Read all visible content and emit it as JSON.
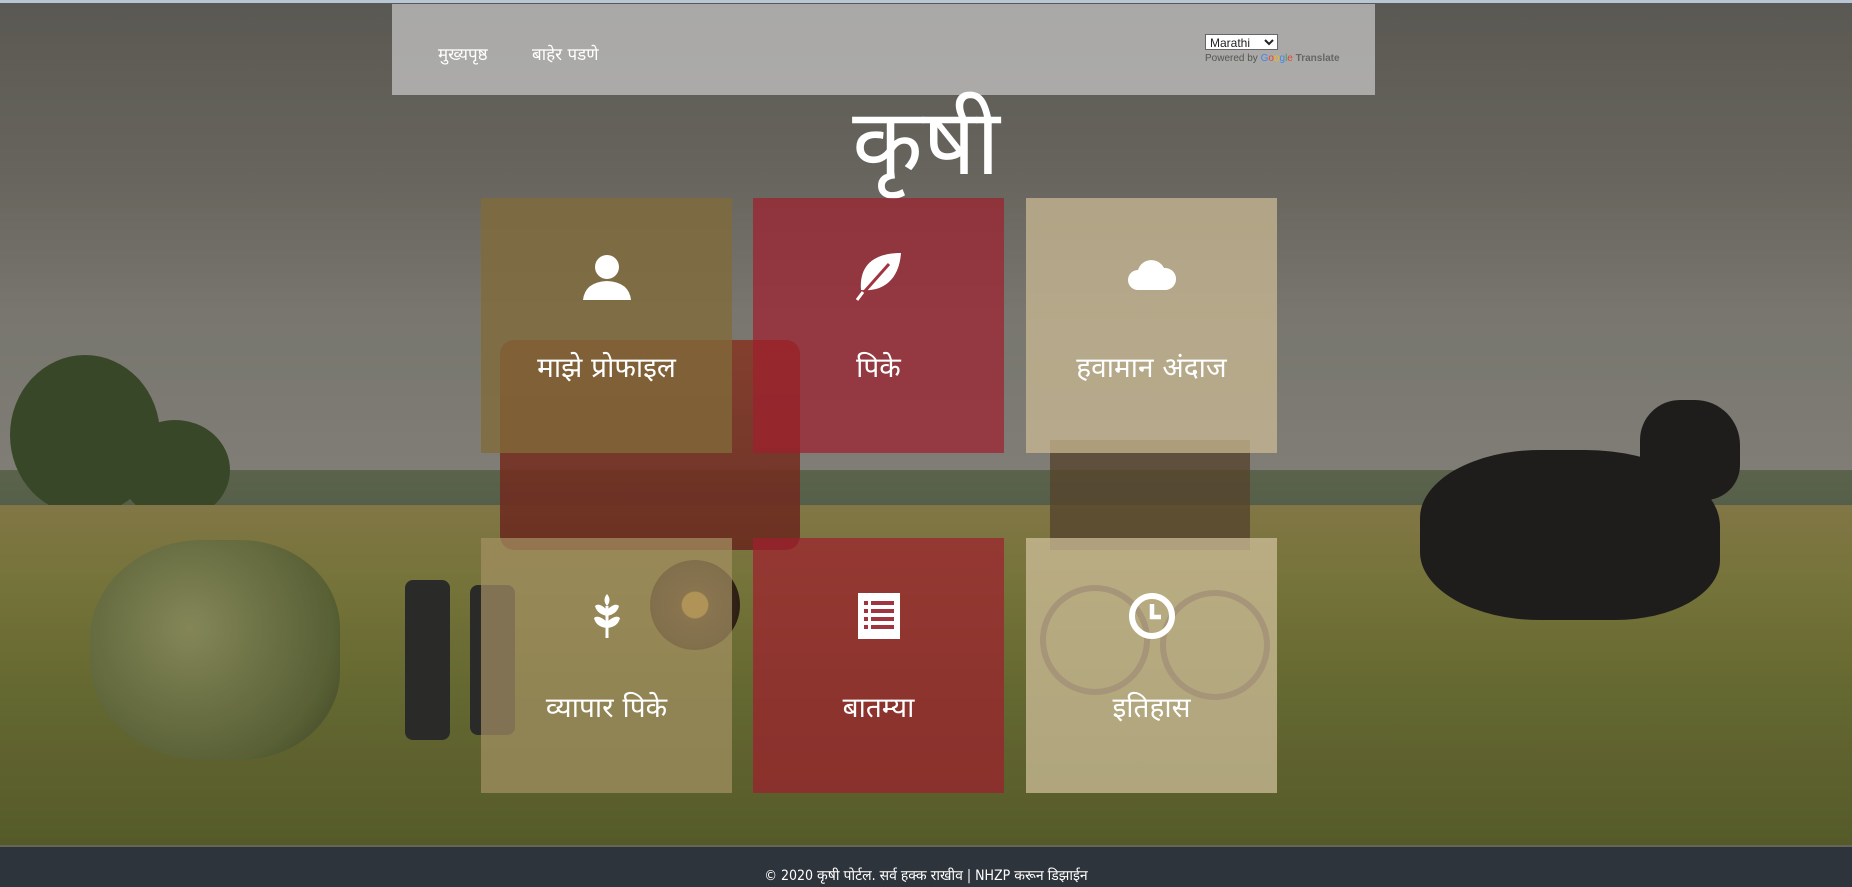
{
  "nav": {
    "home": "मुख्यपृष्ठ",
    "logout": "बाहेर पडणे"
  },
  "translate": {
    "selected_language": "Marathi",
    "powered_by": "Powered by",
    "google": "Google",
    "translate": "Translate"
  },
  "title": "कृषी",
  "tiles": [
    {
      "label": "माझे प्रोफाइल",
      "icon": "user-icon"
    },
    {
      "label": "पिके",
      "icon": "leaf-icon"
    },
    {
      "label": "हवामान अंदाज",
      "icon": "cloud-icon"
    },
    {
      "label": "व्यापार पिके",
      "icon": "wheat-icon"
    },
    {
      "label": "बातम्या",
      "icon": "news-list-icon"
    },
    {
      "label": "इतिहास",
      "icon": "clock-icon"
    }
  ],
  "footer": {
    "text": "© 2020 कृषी पोर्टल. सर्व हक्क राखीव | NHZP करून डिझाईन"
  },
  "colors": {
    "tile_red": "#a01e2d",
    "tile_tan_dark": "#806a3a",
    "tile_tan_light": "#cdbb94",
    "footer": "#2e343c"
  }
}
